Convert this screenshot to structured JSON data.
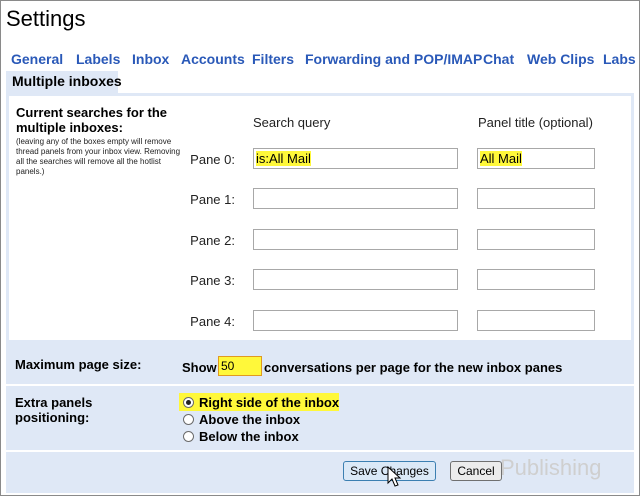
{
  "title": "Settings",
  "tabs": [
    "General",
    "Labels",
    "Inbox",
    "Accounts",
    "Filters",
    "Forwarding and POP/IMAP",
    "Chat",
    "Web Clips",
    "Labs"
  ],
  "active_tab": "Multiple inboxes",
  "searches": {
    "heading": "Current searches for the multiple inboxes:",
    "note": "(leaving any of the boxes empty will remove thread panels from your inbox view. Removing all the searches will remove all the hotlist panels.)",
    "col_query": "Search query",
    "col_title": "Panel title (optional)",
    "panes": [
      {
        "label": "Pane 0:",
        "query": "is:All Mail",
        "title": "All Mail"
      },
      {
        "label": "Pane 1:",
        "query": "",
        "title": ""
      },
      {
        "label": "Pane 2:",
        "query": "",
        "title": ""
      },
      {
        "label": "Pane 3:",
        "query": "",
        "title": ""
      },
      {
        "label": "Pane 4:",
        "query": "",
        "title": ""
      }
    ]
  },
  "page_size": {
    "label": "Maximum page size:",
    "prefix": "Show",
    "value": "50",
    "suffix": "conversations per page for the new inbox panes"
  },
  "positioning": {
    "label": "Extra panels positioning:",
    "options": [
      {
        "label": "Right side of the inbox",
        "selected": true
      },
      {
        "label": "Above the inbox",
        "selected": false
      },
      {
        "label": "Below the inbox",
        "selected": false
      }
    ]
  },
  "buttons": {
    "save": "Save Changes",
    "cancel": "Cancel"
  },
  "watermark": "Publishing",
  "colors": {
    "link": "#2a59b8",
    "panel": "#dfe8f6",
    "highlight": "#fff83a"
  }
}
